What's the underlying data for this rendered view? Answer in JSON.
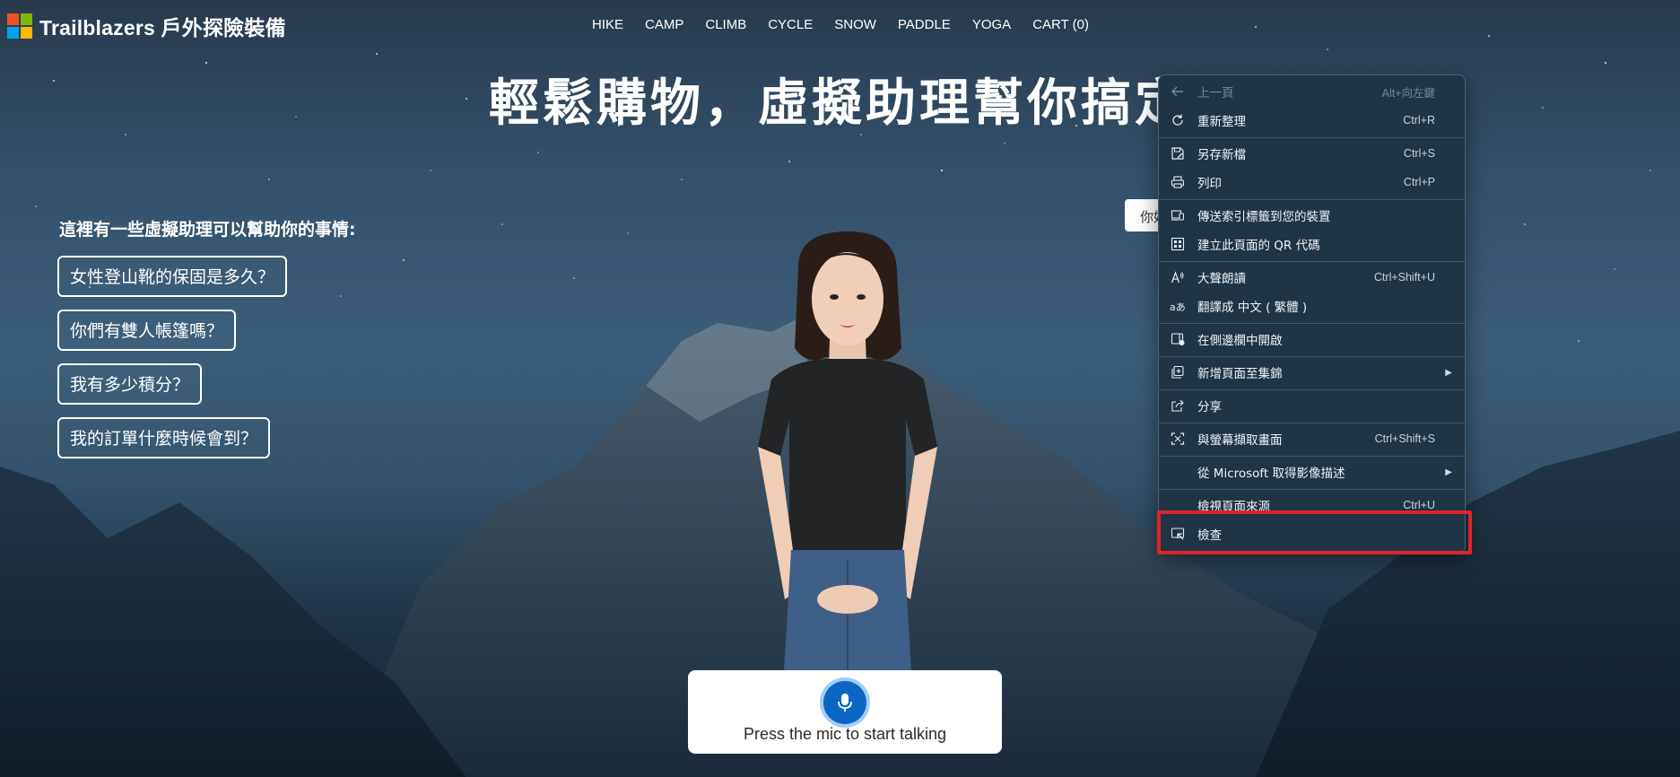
{
  "brand": {
    "name": "Trailblazers 戶外探險裝備"
  },
  "nav": [
    "HIKE",
    "CAMP",
    "CLIMB",
    "CYCLE",
    "SNOW",
    "PADDLE",
    "YOGA",
    "CART (0)"
  ],
  "hero": {
    "title": "輕鬆購物，虛擬助理幫你搞定"
  },
  "helper": {
    "title": "這裡有一些虛擬助理可以幫助你的事情:",
    "suggestions": [
      "女性登山靴的保固是多久？",
      "你們有雙人帳篷嗎？",
      "我有多少積分？",
      "我的訂單什麼時候會到？"
    ]
  },
  "chip": {
    "text": "你好"
  },
  "mic": {
    "label": "Press the mic to start talking"
  },
  "context_menu": {
    "items": [
      {
        "label": "上一頁",
        "shortcut": "Alt+向左鍵",
        "icon": "back-arrow-icon",
        "disabled": true
      },
      {
        "label": "重新整理",
        "shortcut": "Ctrl+R",
        "icon": "refresh-icon"
      },
      {
        "label": "另存新檔",
        "shortcut": "Ctrl+S",
        "icon": "save-as-icon"
      },
      {
        "label": "列印",
        "shortcut": "Ctrl+P",
        "icon": "printer-icon"
      },
      {
        "label": "傳送索引標籤到您的裝置",
        "shortcut": "",
        "icon": "send-tab-icon"
      },
      {
        "label": "建立此頁面的 QR 代碼",
        "shortcut": "",
        "icon": "qr-code-icon"
      },
      {
        "label": "大聲朗讀",
        "shortcut": "Ctrl+Shift+U",
        "icon": "read-aloud-icon"
      },
      {
        "label": "翻譯成 中文 ( 繁體 )",
        "shortcut": "",
        "icon": "translate-icon"
      },
      {
        "label": "在側邊欄中開啟",
        "shortcut": "",
        "icon": "sidebar-icon"
      },
      {
        "label": "新增頁面至集錦",
        "shortcut": "",
        "icon": "collections-icon",
        "submenu": true
      },
      {
        "label": "分享",
        "shortcut": "",
        "icon": "share-icon"
      },
      {
        "label": "與螢幕擷取畫面",
        "shortcut": "Ctrl+Shift+S",
        "icon": "screenshot-icon"
      },
      {
        "label": "從 Microsoft 取得影像描述",
        "shortcut": "",
        "icon": "",
        "submenu": true
      },
      {
        "label": "檢視頁面來源",
        "shortcut": "Ctrl+U",
        "icon": ""
      },
      {
        "label": "檢查",
        "shortcut": "",
        "icon": "inspect-icon"
      }
    ]
  },
  "colors": {
    "highlight": "#e0232a",
    "mic": "#0a66c2",
    "menu_bg": "#1f3445"
  }
}
